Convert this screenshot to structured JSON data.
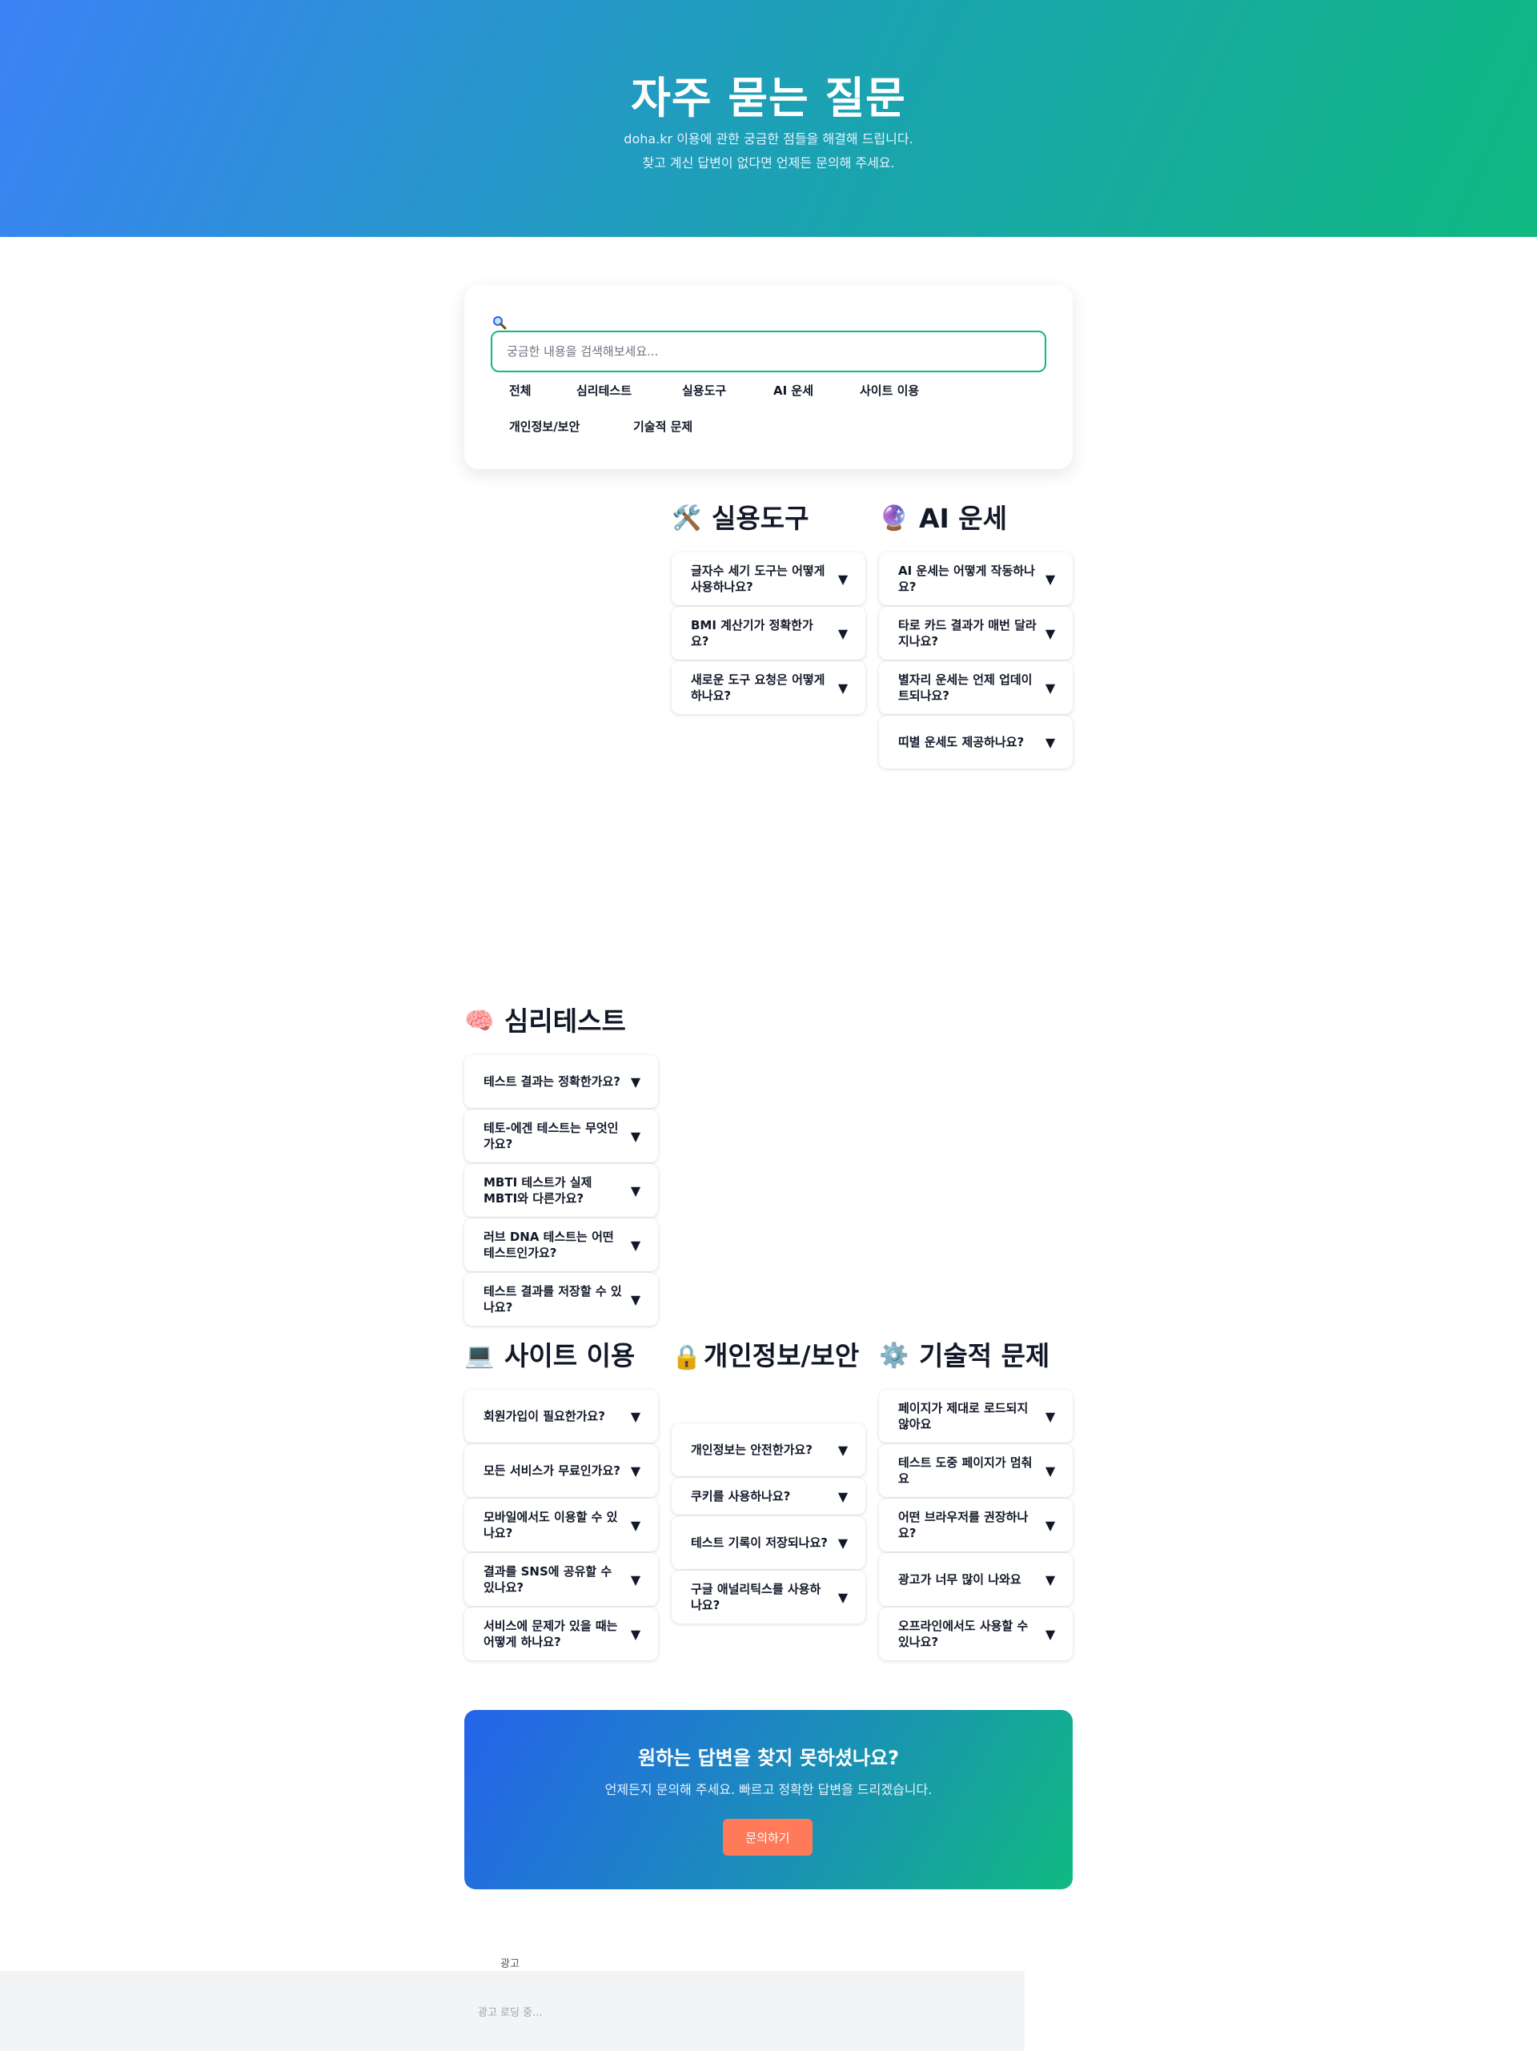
{
  "hero": {
    "title": "자주 묻는 질문",
    "subtitle_line1": "doha.kr 이용에 관한 궁금한 점들을 해결해 드립니다.",
    "subtitle_line2": "찾고 계신 답변이 없다면 언제든 문의해 주세요."
  },
  "search": {
    "icon": "magnifier-icon",
    "placeholder": "궁금한 내용을 검색해보세요..."
  },
  "categories": [
    "전체",
    "심리테스트",
    "실용도구",
    "AI 운세",
    "사이트 이용",
    "개인정보/보안",
    "기술적 문제"
  ],
  "sections": {
    "tools": {
      "emoji": "🛠️",
      "title": "실용도구",
      "items": [
        "글자수 세기 도구는 어떻게 사용하나요?",
        "BMI 계산기가 정확한가요?",
        "새로운 도구 요청은 어떻게 하나요?"
      ]
    },
    "fortune": {
      "emoji": "🔮",
      "title": "AI 운세",
      "items": [
        "AI 운세는 어떻게 작동하나요?",
        "타로 카드 결과가 매번 달라지나요?",
        "별자리 운세는 언제 업데이트되나요?",
        "띠별 운세도 제공하나요?"
      ]
    },
    "psych": {
      "emoji": "🧠",
      "title": "심리테스트",
      "items": [
        "테스트 결과는 정확한가요?",
        "테토-에겐 테스트는 무엇인가요?",
        "MBTI 테스트가 실제 MBTI와 다른가요?",
        "러브 DNA 테스트는 어떤 테스트인가요?",
        "테스트 결과를 저장할 수 있나요?"
      ]
    },
    "site": {
      "emoji": "💻",
      "title": "사이트 이용",
      "items": [
        "회원가입이 필요한가요?",
        "모든 서비스가 무료인가요?",
        "모바일에서도 이용할 수 있나요?",
        "결과를 SNS에 공유할 수 있나요?",
        "서비스에 문제가 있을 때는 어떻게 하나요?"
      ]
    },
    "privacy": {
      "emoji": "🔒",
      "title": "개인정보/보안",
      "items": [
        "개인정보는 안전한가요?",
        "쿠키를 사용하나요?",
        "테스트 기록이 저장되나요?",
        "구글 애널리틱스를 사용하나요?"
      ]
    },
    "tech": {
      "emoji": "⚙️",
      "title": "기술적 문제",
      "items": [
        "페이지가 제대로 로드되지 않아요",
        "테스트 도중 페이지가 멈춰요",
        "어떤 브라우저를 권장하나요?",
        "광고가 너무 많이 나와요",
        "오프라인에서도 사용할 수 있나요?"
      ]
    }
  },
  "cta": {
    "title": "원하는 답변을 찾지 못하셨나요?",
    "text": "언제든지 문의해 주세요. 빠르고 정확한 답변을 드리겠습니다.",
    "button": "문의하기"
  },
  "ad": {
    "label": "광고",
    "loading": "광고 로딩 중..."
  },
  "colors": {
    "accent_green": "#10b981",
    "accent_blue": "#3b82f6",
    "cta_button": "#ff7a59"
  }
}
